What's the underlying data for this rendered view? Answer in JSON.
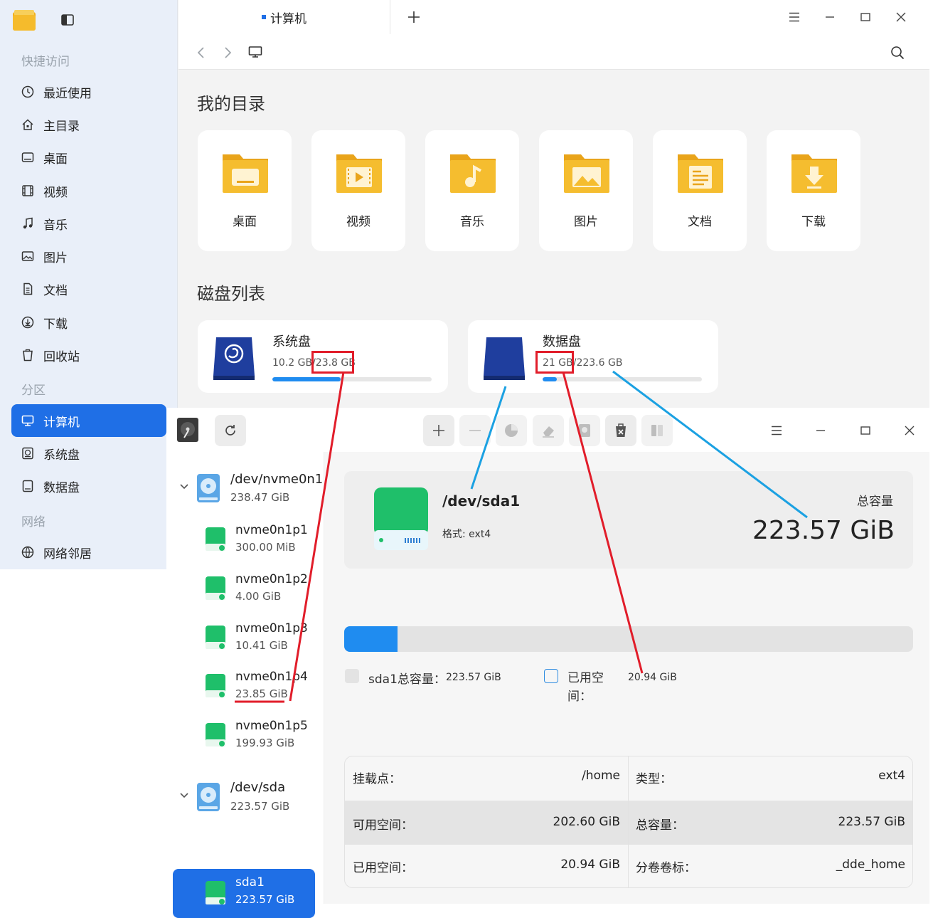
{
  "file_manager": {
    "tab_title": "计算机",
    "sidebar": {
      "quick_access_label": "快捷访问",
      "quick_items": [
        {
          "label": "最近使用",
          "icon": "clock-icon"
        },
        {
          "label": "主目录",
          "icon": "home-icon"
        },
        {
          "label": "桌面",
          "icon": "desktop-icon"
        },
        {
          "label": "视频",
          "icon": "film-icon"
        },
        {
          "label": "音乐",
          "icon": "music-icon"
        },
        {
          "label": "图片",
          "icon": "image-icon"
        },
        {
          "label": "文档",
          "icon": "document-icon"
        },
        {
          "label": "下载",
          "icon": "download-icon"
        },
        {
          "label": "回收站",
          "icon": "trash-icon"
        }
      ],
      "partition_label": "分区",
      "partition_items": [
        {
          "label": "计算机",
          "icon": "computer-icon",
          "active": true
        },
        {
          "label": "系统盘",
          "icon": "disk-icon"
        },
        {
          "label": "数据盘",
          "icon": "drive-icon"
        }
      ],
      "network_label": "网络",
      "network_items": [
        {
          "label": "网络邻居",
          "icon": "network-icon"
        }
      ]
    },
    "my_dirs_title": "我的目录",
    "dirs": [
      {
        "label": "桌面",
        "icon": "folder-desktop-icon"
      },
      {
        "label": "视频",
        "icon": "folder-video-icon"
      },
      {
        "label": "音乐",
        "icon": "folder-music-icon"
      },
      {
        "label": "图片",
        "icon": "folder-pictures-icon"
      },
      {
        "label": "文档",
        "icon": "folder-documents-icon"
      },
      {
        "label": "下载",
        "icon": "folder-download-icon"
      }
    ],
    "disks_title": "磁盘列表",
    "disks": [
      {
        "name": "系统盘",
        "used": "10.2 GB",
        "sep": "/",
        "total": "23.8 GB",
        "fraction": 0.43
      },
      {
        "name": "数据盘",
        "used": "21 GB",
        "sep": "/",
        "total": "223.6 GB",
        "fraction": 0.09
      }
    ]
  },
  "disk_utility": {
    "devices": [
      {
        "name": "/dev/nvme0n1",
        "size": "238.47 GiB",
        "partitions": [
          {
            "name": "nvme0n1p1",
            "size": "300.00 MiB"
          },
          {
            "name": "nvme0n1p2",
            "size": "4.00 GiB"
          },
          {
            "name": "nvme0n1p3",
            "size": "10.41 GiB"
          },
          {
            "name": "nvme0n1p4",
            "size": "23.85 GiB"
          },
          {
            "name": "nvme0n1p5",
            "size": "199.93 GiB"
          }
        ]
      },
      {
        "name": "/dev/sda",
        "size": "223.57 GiB",
        "partitions": [
          {
            "name": "sda1",
            "size": "223.57 GiB",
            "selected": true
          }
        ]
      }
    ],
    "detail": {
      "title": "/dev/sda1",
      "format": "格式: ext4",
      "capacity_label": "总容量",
      "capacity_value": "223.57 GiB",
      "used_fraction": 0.094,
      "legend_total_label": "sda1总容量：",
      "legend_total_value": "223.57 GiB",
      "legend_used_label": "已用空间：",
      "legend_used_value": "20.94 GiB",
      "table": [
        {
          "k1": "挂载点：",
          "v1": "/home",
          "k2": "类型：",
          "v2": "ext4"
        },
        {
          "k1": "可用空间：",
          "v1": "202.60 GiB",
          "k2": "总容量：",
          "v2": "223.57 GiB"
        },
        {
          "k1": "已用空间：",
          "v1": "20.94 GiB",
          "k2": "分卷卷标：",
          "v2": "_dde_home"
        }
      ]
    }
  },
  "colors": {
    "accent": "#1f6fe6",
    "bar": "#1f8cf0",
    "annotation_red": "#e11d2a",
    "annotation_blue": "#1ba1e2",
    "drive_green": "#1fbf6a"
  }
}
